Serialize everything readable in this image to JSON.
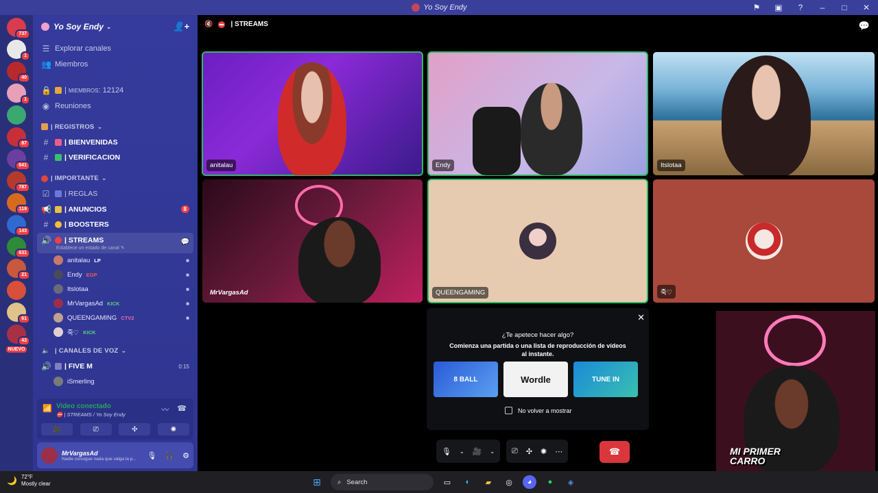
{
  "window": {
    "title": "Yo Soy Endy"
  },
  "rail": {
    "servers": [
      {
        "badge": "737",
        "color": "#d83c4d"
      },
      {
        "badge": "1",
        "color": "#e8e8e8"
      },
      {
        "badge": "40",
        "color": "#b8292e"
      },
      {
        "badge": "1",
        "color": "#e7a0b8"
      },
      {
        "badge": "",
        "color": "#3aa870"
      },
      {
        "badge": "87",
        "color": "#c62f3a"
      },
      {
        "badge": "641",
        "color": "#6b3fa0"
      },
      {
        "badge": "787",
        "color": "#b53a2e"
      },
      {
        "badge": "119",
        "color": "#d86a1f"
      },
      {
        "badge": "143",
        "color": "#2f6ad0"
      },
      {
        "badge": "631",
        "color": "#2e8b3a"
      },
      {
        "badge": "21",
        "color": "#c9583d"
      },
      {
        "badge": "",
        "color": "#d8503a"
      },
      {
        "badge": "61",
        "color": "#e0c38a"
      },
      {
        "badge": "43",
        "color": "#a83045"
      }
    ],
    "new_label": "NUEVO"
  },
  "guild": {
    "name": "Yo Soy Endy"
  },
  "sidebar": {
    "explore": "Explorar canales",
    "members": "Miembros",
    "member_count": "| miembros: 12124",
    "meetings": "Reuniones",
    "cat_registros": "| REGISTROS",
    "ch_bienvenidas": "| BIENVENIDAS",
    "ch_verificacion": "| VERIFICACION",
    "cat_importante": "| IMPORTANTE",
    "ch_reglas": "| REGLAS",
    "ch_anuncios": "| ANUNCIOS",
    "ch_anuncios_badge": "8",
    "ch_boosters": "| BOOSTERS",
    "ch_streams": "| STREAMS",
    "ch_streams_status": "Establece un estado de canal",
    "voice_members": [
      {
        "name": "anitalau",
        "tag": "LP",
        "cam": true
      },
      {
        "name": "Endy",
        "tag": "EGP",
        "cam": true
      },
      {
        "name": "Itslotaa",
        "tag": "",
        "cam": true
      },
      {
        "name": "MrVargasAd",
        "tag": "KICK",
        "cam": true
      },
      {
        "name": "QUEENGAMING",
        "tag": "CTV2",
        "cam": true
      },
      {
        "name": "죽♡",
        "tag": "KICK",
        "cam": false
      }
    ],
    "cat_voz": "| CANALES DE VOZ",
    "ch_fivem": "| FIVE M",
    "ch_fivem_time": "0:15",
    "fivem_member": "iSmerling"
  },
  "voice_panel": {
    "status": "Video conectado",
    "channel": "| STREAMS / Yo Soy Endy"
  },
  "user": {
    "name": "MrVargasAd",
    "status": "Nadie consigue nada que valga la p..."
  },
  "stage": {
    "channel": "| STREAMS",
    "tiles": [
      {
        "label": "anitalau"
      },
      {
        "label": "Endy"
      },
      {
        "label": "Itslotaa"
      },
      {
        "label": "MrVargasAd"
      },
      {
        "label": "QUEENGAMING"
      },
      {
        "label": "죽♡"
      }
    ]
  },
  "activity": {
    "question": "¿Te apetece hacer algo?",
    "description": "Comienza una partida o una lista de reproducción de vídeos al instante.",
    "cards": [
      "8 BALL",
      "Wordle",
      "TUNE IN"
    ],
    "checkbox_label": "No volver a mostrar"
  },
  "pip": {
    "caption": "MI PRIMER CARRO"
  },
  "taskbar": {
    "temperature": "72°F",
    "weather": "Mostly clear",
    "search_placeholder": "Search"
  },
  "colors": {
    "accent_green": "#23a55a",
    "hangup_red": "#da373c",
    "sidebar_bg": "#353b9c"
  }
}
